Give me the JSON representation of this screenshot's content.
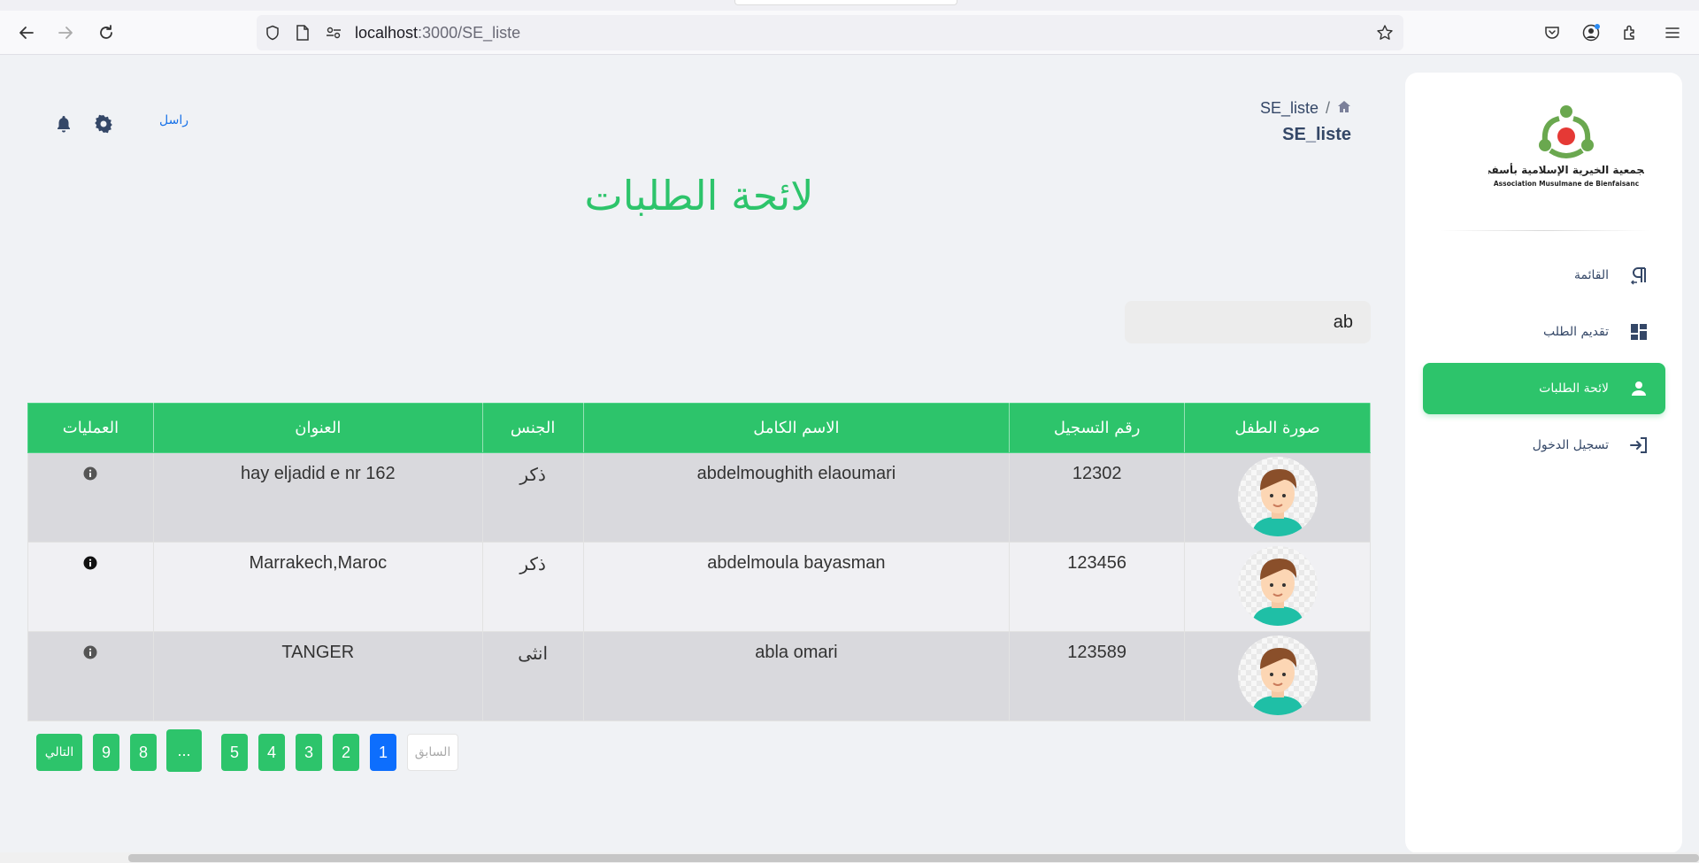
{
  "browser": {
    "url_host": "localhost",
    "url_path": ":3000/SE_liste"
  },
  "sidebar": {
    "logo_text_ar": "الجمعية الخيرية الإسلامية بأسفي",
    "logo_text_fr": "Association Musulmane de Bienfaisanc",
    "items": [
      {
        "label": "القائمة",
        "icon": "pilcrow-icon"
      },
      {
        "label": "تقديم الطلب",
        "icon": "dashboard-icon"
      },
      {
        "label": "لائحة الطلبات",
        "icon": "person-icon",
        "active": true
      },
      {
        "label": "تسجيل الدخول",
        "icon": "login-icon"
      }
    ]
  },
  "header": {
    "breadcrumb_current": "SE_liste",
    "title": "SE_liste",
    "send_link": "راسل"
  },
  "main": {
    "title": "لائحة الطلبات",
    "search_value": "ab"
  },
  "table": {
    "headers": [
      "صورة الطفل",
      "رقم التسجيل",
      "الاسم الكامل",
      "الجنس",
      "العنوان",
      "العمليات"
    ],
    "rows": [
      {
        "reg": "12302",
        "name": "abdelmoughith elaoumari",
        "gender": "ذكر",
        "address": "hay eljadid e nr 162"
      },
      {
        "reg": "123456",
        "name": "abdelmoula bayasman",
        "gender": "ذكر",
        "address": "Marrakech,Maroc"
      },
      {
        "reg": "123589",
        "name": "abla omari",
        "gender": "انثى",
        "address": "TANGER"
      }
    ]
  },
  "pagination": {
    "prev": "السابق",
    "pages": [
      "1",
      "2",
      "3",
      "4",
      "5"
    ],
    "ellipsis": "...",
    "tail_pages": [
      "8",
      "9"
    ],
    "next": "التالي",
    "current": "1"
  },
  "colors": {
    "accent": "#2dc46b",
    "active_page": "#0d6efd",
    "background": "#f0f2f5"
  }
}
